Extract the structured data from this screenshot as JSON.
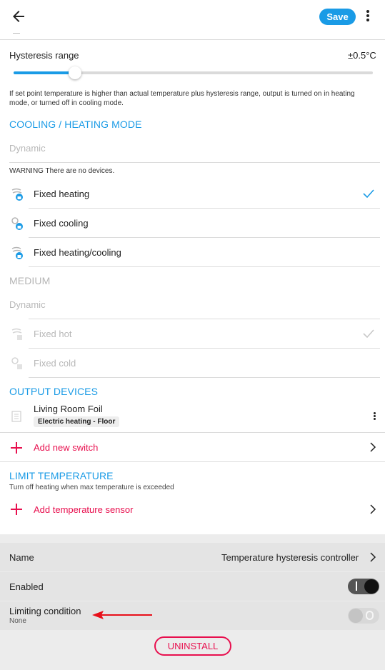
{
  "toolbar": {
    "save_label": "Save"
  },
  "hysteresis": {
    "label": "Hysteresis range",
    "value": "±0.5°C",
    "slider_level": 0.17,
    "description": "If set point temperature is higher than actual temperature plus hysteresis range, output is turned on in heating mode, or turned off in cooling mode."
  },
  "cooling_heating": {
    "title": "COOLING / HEATING MODE",
    "dynamic_placeholder": "Dynamic",
    "warning": "WARNING There are no devices.",
    "options": [
      {
        "label": "Fixed heating",
        "icon": "heating-lock-icon",
        "selected": true
      },
      {
        "label": "Fixed cooling",
        "icon": "cooling-lock-icon",
        "selected": false
      },
      {
        "label": "Fixed heating/cooling",
        "icon": "heating-cooling-lock-icon",
        "selected": false
      }
    ]
  },
  "medium": {
    "title": "MEDIUM",
    "dynamic_placeholder": "Dynamic",
    "options": [
      {
        "label": "Fixed hot",
        "selected": true
      },
      {
        "label": "Fixed cold",
        "selected": false
      }
    ]
  },
  "output_devices": {
    "title": "OUTPUT DEVICES",
    "device_name": "Living Room Foil",
    "device_tag": "Electric heating - Floor",
    "add_label": "Add new switch"
  },
  "limit_temperature": {
    "title": "LIMIT TEMPERATURE",
    "subtitle": "Turn off heating when max temperature is exceeded",
    "add_label": "Add temperature sensor"
  },
  "settings": {
    "name_label": "Name",
    "name_value": "Temperature hysteresis controller",
    "enabled_label": "Enabled",
    "enabled": true,
    "limiting_label": "Limiting condition",
    "limiting_value": "None",
    "limiting_enabled": false
  },
  "uninstall_label": "UNINSTALL",
  "colors": {
    "accent": "#1a9be6",
    "danger": "#e8104f"
  }
}
